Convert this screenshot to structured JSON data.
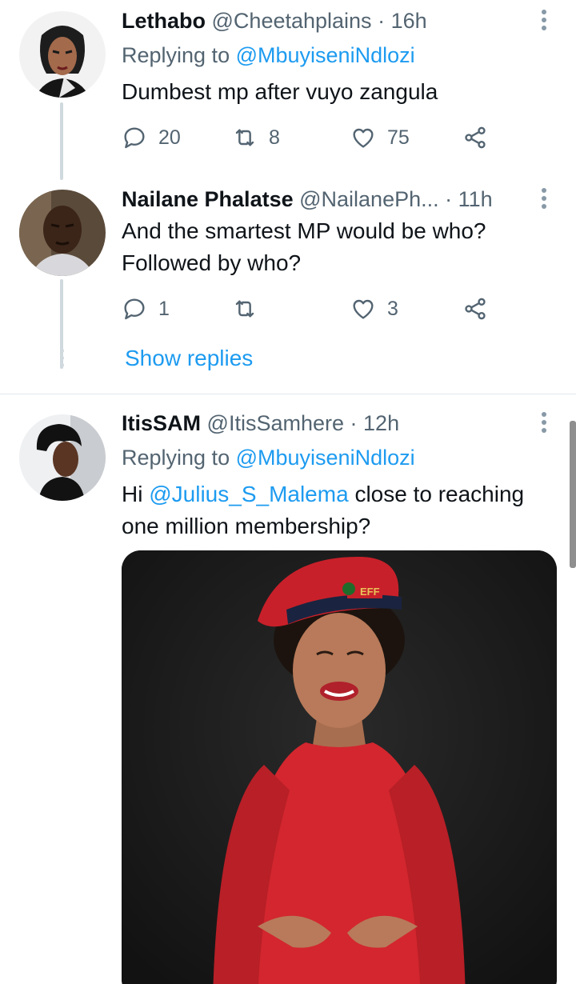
{
  "tweets": [
    {
      "name": "Lethabo",
      "handle": "@Cheetahplains",
      "sep": "·",
      "time": "16h",
      "replying_prefix": "Replying to",
      "replying_to": "@MbuyiseniNdlozi",
      "text": "Dumbest mp after vuyo zangula",
      "replies": "20",
      "retweets": "8",
      "likes": "75"
    },
    {
      "name": "Nailane Phalatse",
      "handle": "@NailanePh...",
      "sep": "·",
      "time": "11h",
      "text_line1": "And the smartest MP would be who?",
      "text_line2": "Followed by who?",
      "replies": "1",
      "retweets": "",
      "likes": "3"
    },
    {
      "name": "ItisSAM",
      "handle": "@ItisSamhere",
      "sep": "·",
      "time": "12h",
      "replying_prefix": "Replying to",
      "replying_to": "@MbuyiseniNdlozi",
      "text_prefix": "Hi",
      "text_mention": "@Julius_S_Malema",
      "text_rest": "close to reaching",
      "text_line2": "one million membership?",
      "media_badge": "EFF"
    }
  ],
  "show_replies": "Show replies",
  "colors": {
    "link": "#1d9bf0",
    "secondary": "#536471",
    "thread_line": "#cfd9de",
    "beret_red": "#c8202a",
    "dress_red": "#d3262e"
  },
  "icons": {
    "reply": "reply-icon",
    "retweet": "retweet-icon",
    "like": "heart-icon",
    "share": "share-icon",
    "more": "more-dots-icon"
  }
}
